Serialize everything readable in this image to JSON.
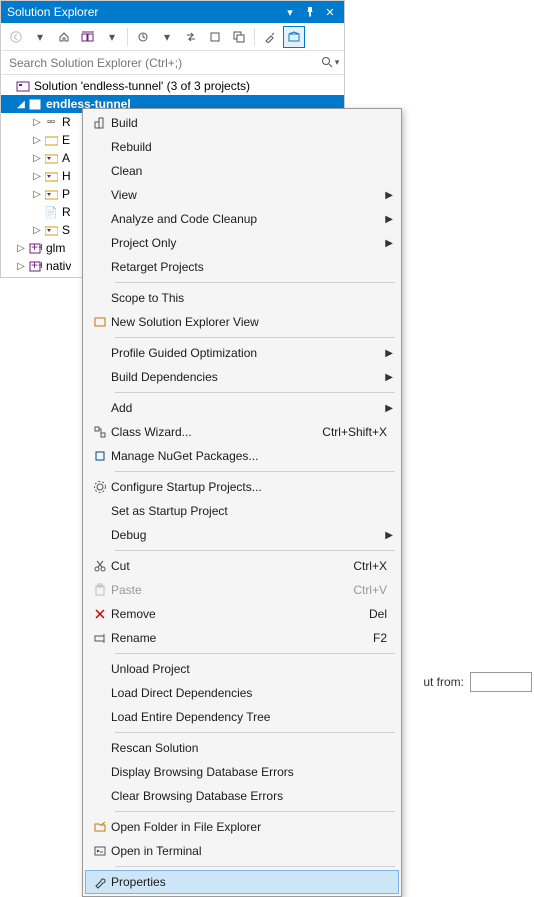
{
  "titlebar": {
    "title": "Solution Explorer"
  },
  "search": {
    "placeholder": "Search Solution Explorer (Ctrl+;)"
  },
  "tree": {
    "solution": "Solution 'endless-tunnel' (3 of 3 projects)",
    "project": "endless-tunnel",
    "items": [
      "R",
      "E",
      "A",
      "H",
      "P",
      "R",
      "S"
    ],
    "siblings": [
      "glm",
      "nativ"
    ]
  },
  "menu": {
    "build": "Build",
    "rebuild": "Rebuild",
    "clean": "Clean",
    "view": "View",
    "analyze": "Analyze and Code Cleanup",
    "project_only": "Project Only",
    "retarget": "Retarget Projects",
    "scope": "Scope to This",
    "new_solution_view": "New Solution Explorer View",
    "profile_guided": "Profile Guided Optimization",
    "build_deps": "Build Dependencies",
    "add": "Add",
    "class_wizard": "Class Wizard...",
    "class_wizard_sc": "Ctrl+Shift+X",
    "manage_nuget": "Manage NuGet Packages...",
    "configure_startup": "Configure Startup Projects...",
    "set_startup": "Set as Startup Project",
    "debug": "Debug",
    "cut": "Cut",
    "cut_sc": "Ctrl+X",
    "paste": "Paste",
    "paste_sc": "Ctrl+V",
    "remove": "Remove",
    "remove_sc": "Del",
    "rename": "Rename",
    "rename_sc": "F2",
    "unload": "Unload Project",
    "load_direct": "Load Direct Dependencies",
    "load_entire": "Load Entire Dependency Tree",
    "rescan": "Rescan Solution",
    "display_browse_err": "Display Browsing Database Errors",
    "clear_browse_err": "Clear Browsing Database Errors",
    "open_folder": "Open Folder in File Explorer",
    "open_terminal": "Open in Terminal",
    "properties": "Properties"
  },
  "bg": {
    "label": "ut from:"
  }
}
